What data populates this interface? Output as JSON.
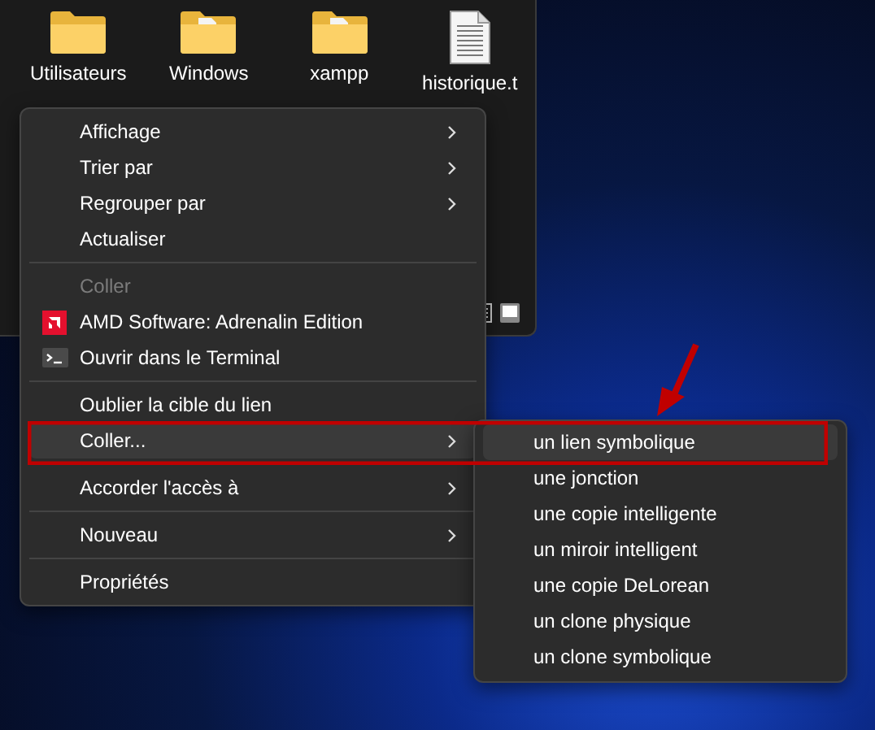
{
  "files": [
    {
      "name": "Utilisateurs",
      "kind": "folder"
    },
    {
      "name": "Windows",
      "kind": "folder-doc"
    },
    {
      "name": "xampp",
      "kind": "folder-doc"
    },
    {
      "name": "historique.t",
      "kind": "text-file"
    }
  ],
  "context_menu": {
    "items": [
      {
        "kind": "item",
        "label": "Affichage",
        "has_submenu": true,
        "disabled": false,
        "selected": false
      },
      {
        "kind": "item",
        "label": "Trier par",
        "has_submenu": true,
        "disabled": false,
        "selected": false
      },
      {
        "kind": "item",
        "label": "Regrouper par",
        "has_submenu": true,
        "disabled": false,
        "selected": false
      },
      {
        "kind": "item",
        "label": "Actualiser",
        "has_submenu": false,
        "disabled": false,
        "selected": false
      },
      {
        "kind": "separator"
      },
      {
        "kind": "item",
        "label": "Coller",
        "has_submenu": false,
        "disabled": true,
        "selected": false
      },
      {
        "kind": "amd",
        "label": "AMD Software: Adrenalin Edition",
        "has_submenu": false,
        "disabled": false,
        "selected": false
      },
      {
        "kind": "terminal",
        "label": "Ouvrir dans le Terminal",
        "has_submenu": false,
        "disabled": false,
        "selected": false
      },
      {
        "kind": "separator"
      },
      {
        "kind": "item",
        "label": "Oublier la cible du lien",
        "has_submenu": false,
        "disabled": false,
        "selected": false
      },
      {
        "kind": "item",
        "label": "Coller...",
        "has_submenu": true,
        "disabled": false,
        "selected": true
      },
      {
        "kind": "separator"
      },
      {
        "kind": "item",
        "label": "Accorder l'accès à",
        "has_submenu": true,
        "disabled": false,
        "selected": false
      },
      {
        "kind": "separator"
      },
      {
        "kind": "item",
        "label": "Nouveau",
        "has_submenu": true,
        "disabled": false,
        "selected": false
      },
      {
        "kind": "separator"
      },
      {
        "kind": "item",
        "label": "Propriétés",
        "has_submenu": false,
        "disabled": false,
        "selected": false
      }
    ]
  },
  "submenu": {
    "items": [
      {
        "label": "un lien symbolique",
        "selected": true
      },
      {
        "label": "une jonction",
        "selected": false
      },
      {
        "label": "une copie intelligente",
        "selected": false
      },
      {
        "label": "un miroir intelligent",
        "selected": false
      },
      {
        "label": "une copie DeLorean",
        "selected": false
      },
      {
        "label": "un clone physique",
        "selected": false
      },
      {
        "label": "un clone symbolique",
        "selected": false
      }
    ]
  }
}
